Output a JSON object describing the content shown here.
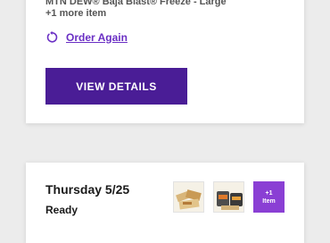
{
  "order_card_1": {
    "items_text": "MTN DEW® Baja Blast® Freeze - Large",
    "more_items": "+1 more item",
    "order_again_label": "Order Again",
    "view_details_label": "VIEW DETAILS"
  },
  "order_card_2": {
    "date": "Thursday 5/25",
    "status": "Ready",
    "more_badge_count": "+1",
    "more_badge_label": "Item"
  },
  "colors": {
    "accent": "#6a2fc4",
    "button": "#4a1d96",
    "badge": "#8a3fd4"
  },
  "icons": {
    "order_again": "reorder-icon",
    "thumb_1": "food-item-thumbnail",
    "thumb_2": "food-item-thumbnail"
  }
}
